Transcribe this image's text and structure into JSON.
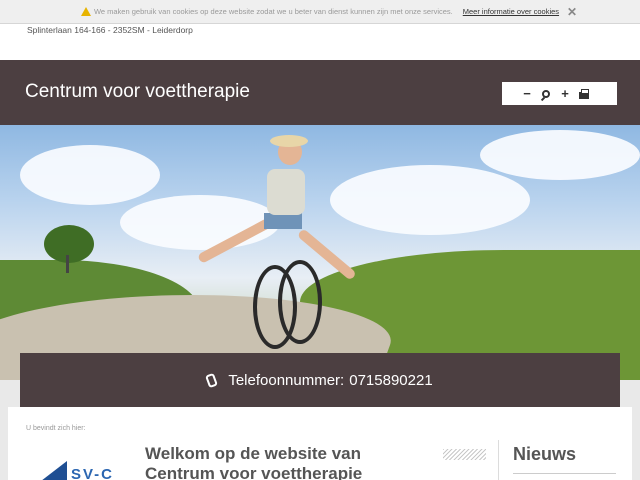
{
  "cookie": {
    "message": "We maken gebruik van cookies op deze website zodat we u beter van dienst kunnen zijn met onze services.",
    "link": "Meer informatie over cookies",
    "close_glyph": "✕"
  },
  "address": "Splinterlaan 164-166 - 2352SM - Leiderdorp",
  "header": {
    "title": "Centrum voor voettherapie",
    "toolbar": {
      "zoom_out": "−",
      "zoom_in": "+"
    }
  },
  "phone": {
    "label": "Telefoonnummer:",
    "number": "0715890221"
  },
  "breadcrumb": "U bevindt zich hier:",
  "logo_text": "SV-C",
  "main": {
    "heading": "Welkom op de website van Centrum voor voettherapie"
  },
  "sidebar": {
    "news_title": "Nieuws"
  },
  "colors": {
    "brand_dark": "#4c3f41",
    "warning": "#e7b400",
    "logo_blue": "#2b66b1"
  }
}
